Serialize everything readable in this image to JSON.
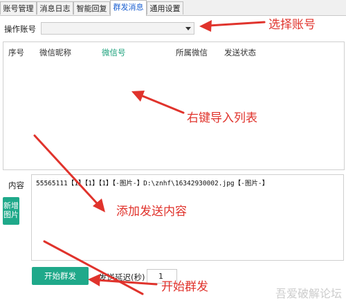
{
  "tabs": [
    {
      "label": "账号管理"
    },
    {
      "label": "消息日志"
    },
    {
      "label": "智能回复"
    },
    {
      "label": "群发消息"
    },
    {
      "label": "通用设置"
    }
  ],
  "active_tab": "群发消息",
  "account": {
    "label": "操作账号",
    "value": ""
  },
  "list": {
    "columns": [
      "序号",
      "微信昵称",
      "微信号",
      "所属微信",
      "发送状态"
    ]
  },
  "content": {
    "label": "内容",
    "text": "55565111【1】【1】【1】【-图片-】D:\\znhf\\16342930002.jpg【-图片-】"
  },
  "add_image_button": {
    "label": "新增图片"
  },
  "start_button": {
    "label": "开始群发"
  },
  "delay": {
    "label": "发送延迟(秒)",
    "value": "1"
  },
  "annotations": {
    "select_account": "选择账号",
    "import_list": "右键导入列表",
    "add_content": "添加发送内容",
    "start": "开始群发"
  },
  "watermark": "吾爱破解论坛",
  "colors": {
    "accent": "#1fa98a",
    "annotation": "#e0332c",
    "active_tab_text": "#1a5fd0"
  }
}
